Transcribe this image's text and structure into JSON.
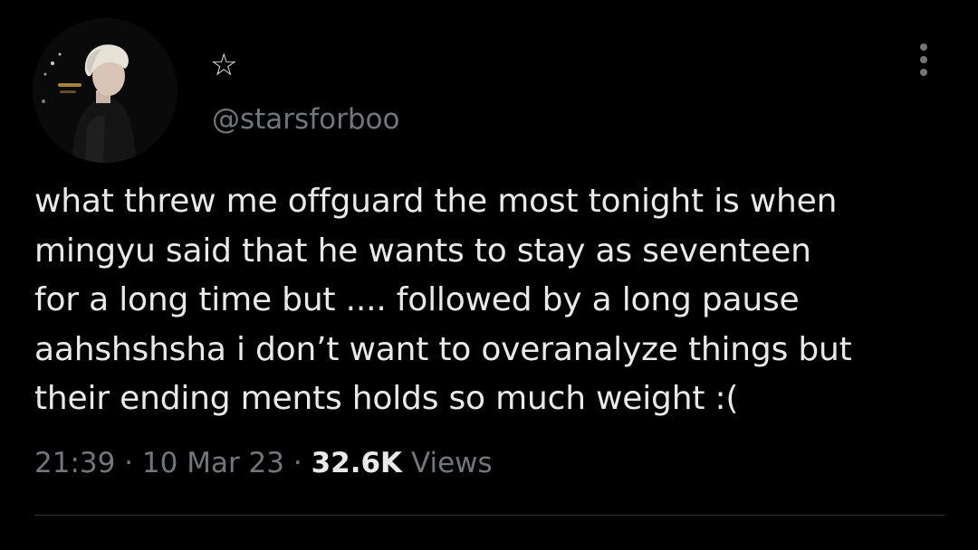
{
  "author": {
    "display_name": "☆",
    "handle": "@starsforboo"
  },
  "tweet": {
    "text_lines": [
      "what threw me offguard the most tonight is when",
      "mingyu said that he wants to stay as seventeen",
      "for a long time but .... followed by a long pause",
      "aahshshsha i don’t want to overanalyze things but",
      "their ending ments holds so much weight :("
    ]
  },
  "meta": {
    "time": "21:39",
    "separator": " · ",
    "date": "10 Mar 23",
    "views_count": "32.6K",
    "views_label": "Views"
  },
  "icons": {
    "more": "more-vertical-icon"
  },
  "colors": {
    "background": "#000000",
    "primary_text": "#e7e9ea",
    "secondary_text": "#71767b",
    "divider": "#2f3336"
  }
}
